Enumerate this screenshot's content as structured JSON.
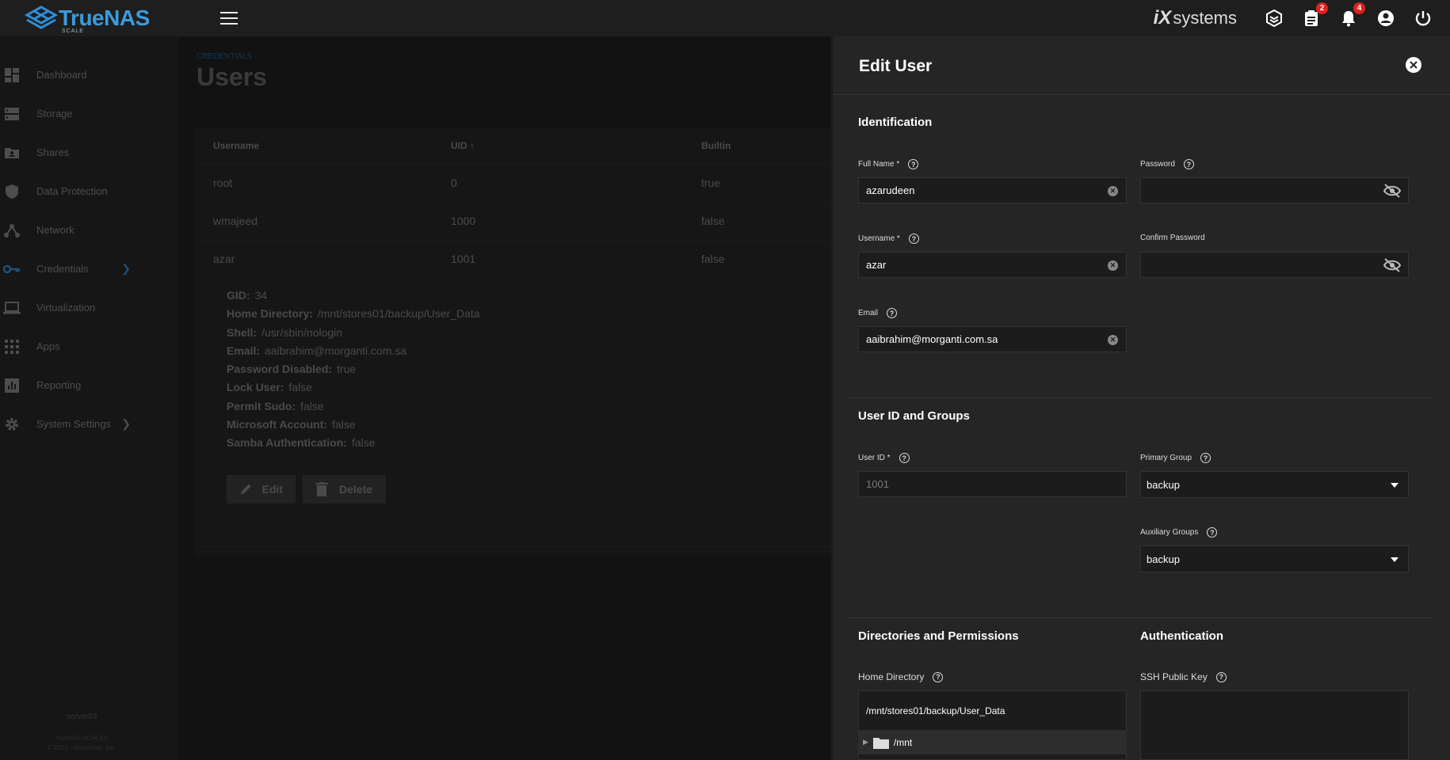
{
  "topbar": {
    "brand": "TrueNAS",
    "brand_sub": "SCALE",
    "vendor_ix": "iX",
    "vendor": "systems",
    "tasks_badge": "2",
    "alerts_badge": "4"
  },
  "sidebar": {
    "items": [
      {
        "label": "Dashboard",
        "icon": "dashboard-icon"
      },
      {
        "label": "Storage",
        "icon": "storage-icon"
      },
      {
        "label": "Shares",
        "icon": "shares-icon"
      },
      {
        "label": "Data Protection",
        "icon": "shield-icon"
      },
      {
        "label": "Network",
        "icon": "network-icon"
      },
      {
        "label": "Credentials",
        "icon": "key-icon"
      },
      {
        "label": "Virtualization",
        "icon": "laptop-icon"
      },
      {
        "label": "Apps",
        "icon": "apps-icon"
      },
      {
        "label": "Reporting",
        "icon": "reporting-icon"
      },
      {
        "label": "System Settings",
        "icon": "gear-icon"
      }
    ],
    "hostname": "server03",
    "version": "TrueNAS SCALE®",
    "copyright": "© 2022 - iXsystems, Inc."
  },
  "main": {
    "breadcrumb": "CREDENTIALS",
    "title": "Users",
    "table": {
      "headers": [
        "Username",
        "UID",
        "Builtin"
      ],
      "rows": [
        {
          "username": "root",
          "uid": "0",
          "builtin": "true"
        },
        {
          "username": "wmajeed",
          "uid": "1000",
          "builtin": "false"
        },
        {
          "username": "azar",
          "uid": "1001",
          "builtin": "false"
        }
      ]
    },
    "details": [
      {
        "k": "GID:",
        "v": "34"
      },
      {
        "k": "Home Directory:",
        "v": "/mnt/stores01/backup/User_Data"
      },
      {
        "k": "Shell:",
        "v": "/usr/sbin/nologin"
      },
      {
        "k": "Email:",
        "v": "aaibrahim@morganti.com.sa"
      },
      {
        "k": "Password Disabled:",
        "v": "true"
      },
      {
        "k": "Lock User:",
        "v": "false"
      },
      {
        "k": "Permit Sudo:",
        "v": "false"
      },
      {
        "k": "Microsoft Account:",
        "v": "false"
      },
      {
        "k": "Samba Authentication:",
        "v": "false"
      }
    ],
    "edit_label": "Edit",
    "delete_label": "Delete"
  },
  "panel": {
    "title": "Edit User",
    "identification": "Identification",
    "full_name_label": "Full Name *",
    "full_name": "azarudeen",
    "password_label": "Password",
    "username_label": "Username *",
    "username": "azar",
    "confirm_password_label": "Confirm Password",
    "email_label": "Email",
    "email": "aaibrahim@morganti.com.sa",
    "uid_groups": "User ID and Groups",
    "uid_label": "User ID *",
    "uid": "1001",
    "primary_group_label": "Primary Group",
    "primary_group": "backup",
    "aux_groups_label": "Auxiliary Groups",
    "aux_groups": "backup",
    "dirs_title": "Directories and Permissions",
    "auth_title": "Authentication",
    "home_dir_label": "Home Directory",
    "home_dir": "/mnt/stores01/backup/User_Data",
    "tree_root": "/mnt",
    "ssh_label": "SSH Public Key"
  }
}
